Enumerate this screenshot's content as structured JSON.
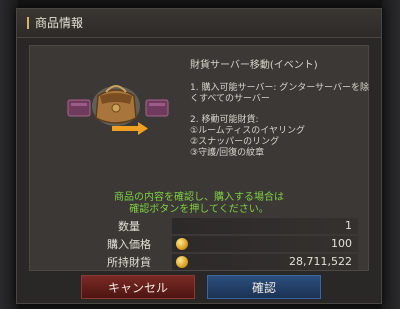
{
  "dialog": {
    "title": "商品情報"
  },
  "item": {
    "name": "財貨サーバー移動(イベント)",
    "line1": "1. 購入可能サーバー: グンターサーバーを除くすべてのサーバー",
    "line2_head": "2. 移動可能財貨:",
    "line2_items": [
      "①ルームティスのイヤリング",
      "②スナッパーのリング",
      "③守護/回復の紋章"
    ]
  },
  "confirm_message": {
    "line1": "商品の内容を確認し、購入する場合は",
    "line2": "確認ボタンを押してください。"
  },
  "rows": {
    "quantity": {
      "label": "数量",
      "value": "1"
    },
    "price": {
      "label": "購入価格",
      "value": "100"
    },
    "balance": {
      "label": "所持財貨",
      "value": "28,711,522"
    }
  },
  "buttons": {
    "cancel": "キャンセル",
    "ok": "確認"
  },
  "colors": {
    "confirm_text": "#7fd043",
    "cancel_button": "#6a231e",
    "ok_button": "#244670",
    "coin": "#e8b23a"
  },
  "icons": [
    "pouch-icon",
    "arrow-right-icon",
    "coin-icon"
  ]
}
